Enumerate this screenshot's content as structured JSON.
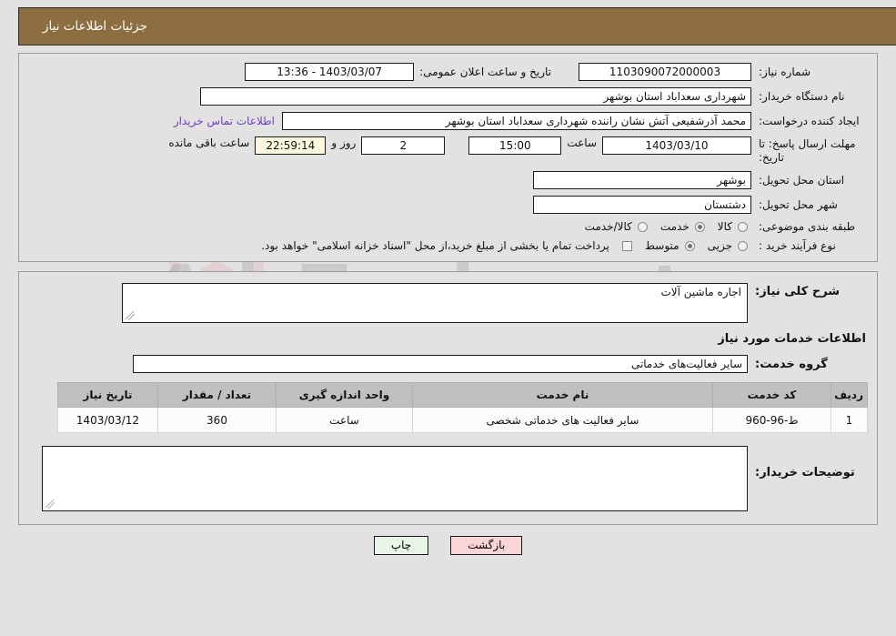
{
  "watermark": {
    "text": "AriaTender.net"
  },
  "header": {
    "title": "جزئیات اطلاعات نیاز"
  },
  "top_section": {
    "need_number_label": "شماره نیاز:",
    "need_number_value": "1103090072000003",
    "announce_datetime_label": "تاریخ و ساعت اعلان عمومی:",
    "announce_datetime_value": "1403/03/07 - 13:36",
    "buyer_org_label": "نام دستگاه خریدار:",
    "buyer_org_value": "شهرداری سعداباد استان بوشهر",
    "requester_label": "ایجاد کننده درخواست:",
    "requester_value": "محمد آذرشفیعی آتش نشان راننده شهرداری سعداباد استان بوشهر",
    "contact_link": "اطلاعات تماس خریدار",
    "deadline_label": "مهلت ارسال پاسخ: تا تاریخ:",
    "deadline_date": "1403/03/10",
    "time_label": "ساعت",
    "deadline_time": "15:00",
    "days_value": "2",
    "days_label": "روز و",
    "countdown_value": "22:59:14",
    "remaining_label": "ساعت باقی مانده",
    "province_label": "استان محل تحویل:",
    "province_value": "بوشهر",
    "city_label": "شهر محل تحویل:",
    "city_value": "دشتستان",
    "category_label": "طبقه بندی موضوعی:",
    "category_options": [
      {
        "label": "کالا",
        "selected": false
      },
      {
        "label": "خدمت",
        "selected": true
      },
      {
        "label": "کالا/خدمت",
        "selected": false
      }
    ],
    "purchase_type_label": "نوع فرآیند خرید :",
    "purchase_type_options": [
      {
        "label": "جزیی",
        "selected": false
      },
      {
        "label": "متوسط",
        "selected": true
      }
    ],
    "treasury_note": "پرداخت تمام یا بخشی از مبلغ خرید،از محل \"اسناد خزانه اسلامی\" خواهد بود."
  },
  "mid_section": {
    "general_desc_label": "شرح کلی نیاز:",
    "general_desc_value": "اجاره ماشین آلات",
    "services_heading": "اطلاعات خدمات مورد نیاز",
    "service_group_label": "گروه خدمت:",
    "service_group_value": "سایر فعالیت‌های خدماتی",
    "table": {
      "headers": [
        "ردیف",
        "کد خدمت",
        "نام خدمت",
        "واحد اندازه گیری",
        "تعداد / مقدار",
        "تاریخ نیاز"
      ],
      "rows": [
        {
          "index": "1",
          "code": "ط-96-960",
          "name": "سایر فعالیت های خدماتی شخصی",
          "unit": "ساعت",
          "quantity": "360",
          "date": "1403/03/12"
        }
      ]
    },
    "buyer_notes_label": "توضیحات خریدار:",
    "buyer_notes_value": ""
  },
  "footer": {
    "print_button": "چاپ",
    "back_button": "بازگشت"
  }
}
